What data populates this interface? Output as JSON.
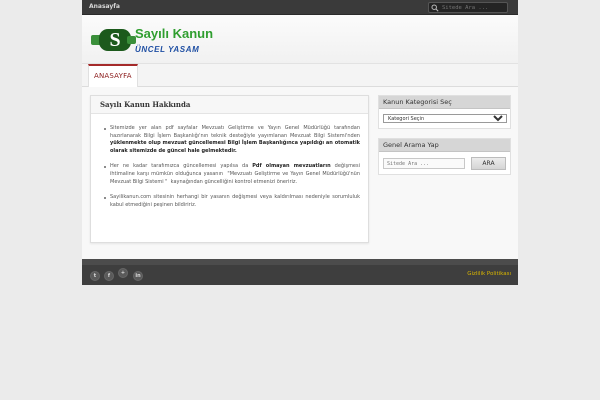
{
  "topbar": {
    "home_link": "Anasayfa",
    "search_placeholder": "Sitede Ara ..."
  },
  "logo": {
    "line1": "Sayılı Kanun",
    "line2": "ÜNCEL YASAM",
    "emblem_letters": "S",
    "colors": {
      "green": "#2f9e2f",
      "dark_green": "#1c5a1c",
      "blue": "#1f4fa3"
    }
  },
  "nav": {
    "items": [
      {
        "label": "ANASAYFA",
        "active": true
      }
    ]
  },
  "main": {
    "title": "Sayılı Kanun Hakkında",
    "paragraphs": [
      {
        "text_a": "Sitemizde yer alan pdf sayfalar Mevzuatı Geliştirme ve Yayın Genel Müdürlüğü tarafından hazırlanarak Bilgi İşlem Başkanlığı'nın teknik desteğiyle yayımlanan Mevzuat Bilgi Sistemi'nden ",
        "bold_a": "yüklenmekte olup mevzuat güncellemesi Bilgi İşlem Başkanlığınca yapıldığı an otomatik olarak sitemizde de güncel hale gelmektedir.",
        "text_b": ""
      },
      {
        "text_a": "Her ne kadar tarafımızca güncellemesi yapılsa da ",
        "bold_a": "Pdf olmayan mevzuatların",
        "text_b": " değişmesi ihtimaline karşı mümkün olduğunca yasanın  \"Mevzuatı Geliştirme ve Yayın Genel Müdürlüğü'nün Mevzuat Bilgi Sistemi \"  kaynağından güncelliğini kontrol etmenizi öneririz."
      },
      {
        "text_a": "Sayilikanun.com sitesinin herhangi bir yasanın değişmesi veya kaldırılması nedeniyle sorumluluk kabul etmediğini peşinen bildiririz.",
        "bold_a": "",
        "text_b": ""
      }
    ]
  },
  "sidebar": {
    "category_widget": {
      "title": "Kanun Kategorisi Seç",
      "selected": "Kategori Seçin"
    },
    "search_widget": {
      "title": "Genel Arama Yap",
      "placeholder": "Sitede Ara ...",
      "button": "ARA"
    }
  },
  "footer": {
    "social_icons": [
      {
        "name": "twitter-icon",
        "glyph": "t"
      },
      {
        "name": "facebook-icon",
        "glyph": "f"
      },
      {
        "name": "googleplus-icon",
        "glyph": "+"
      },
      {
        "name": "linkedin-icon",
        "glyph": "in"
      }
    ],
    "privacy_link": "Gizlilik Politikası"
  },
  "colors": {
    "accent_red": "#a52a2a",
    "footer_link": "#d9b600",
    "topbar": "#3a3a3a"
  }
}
